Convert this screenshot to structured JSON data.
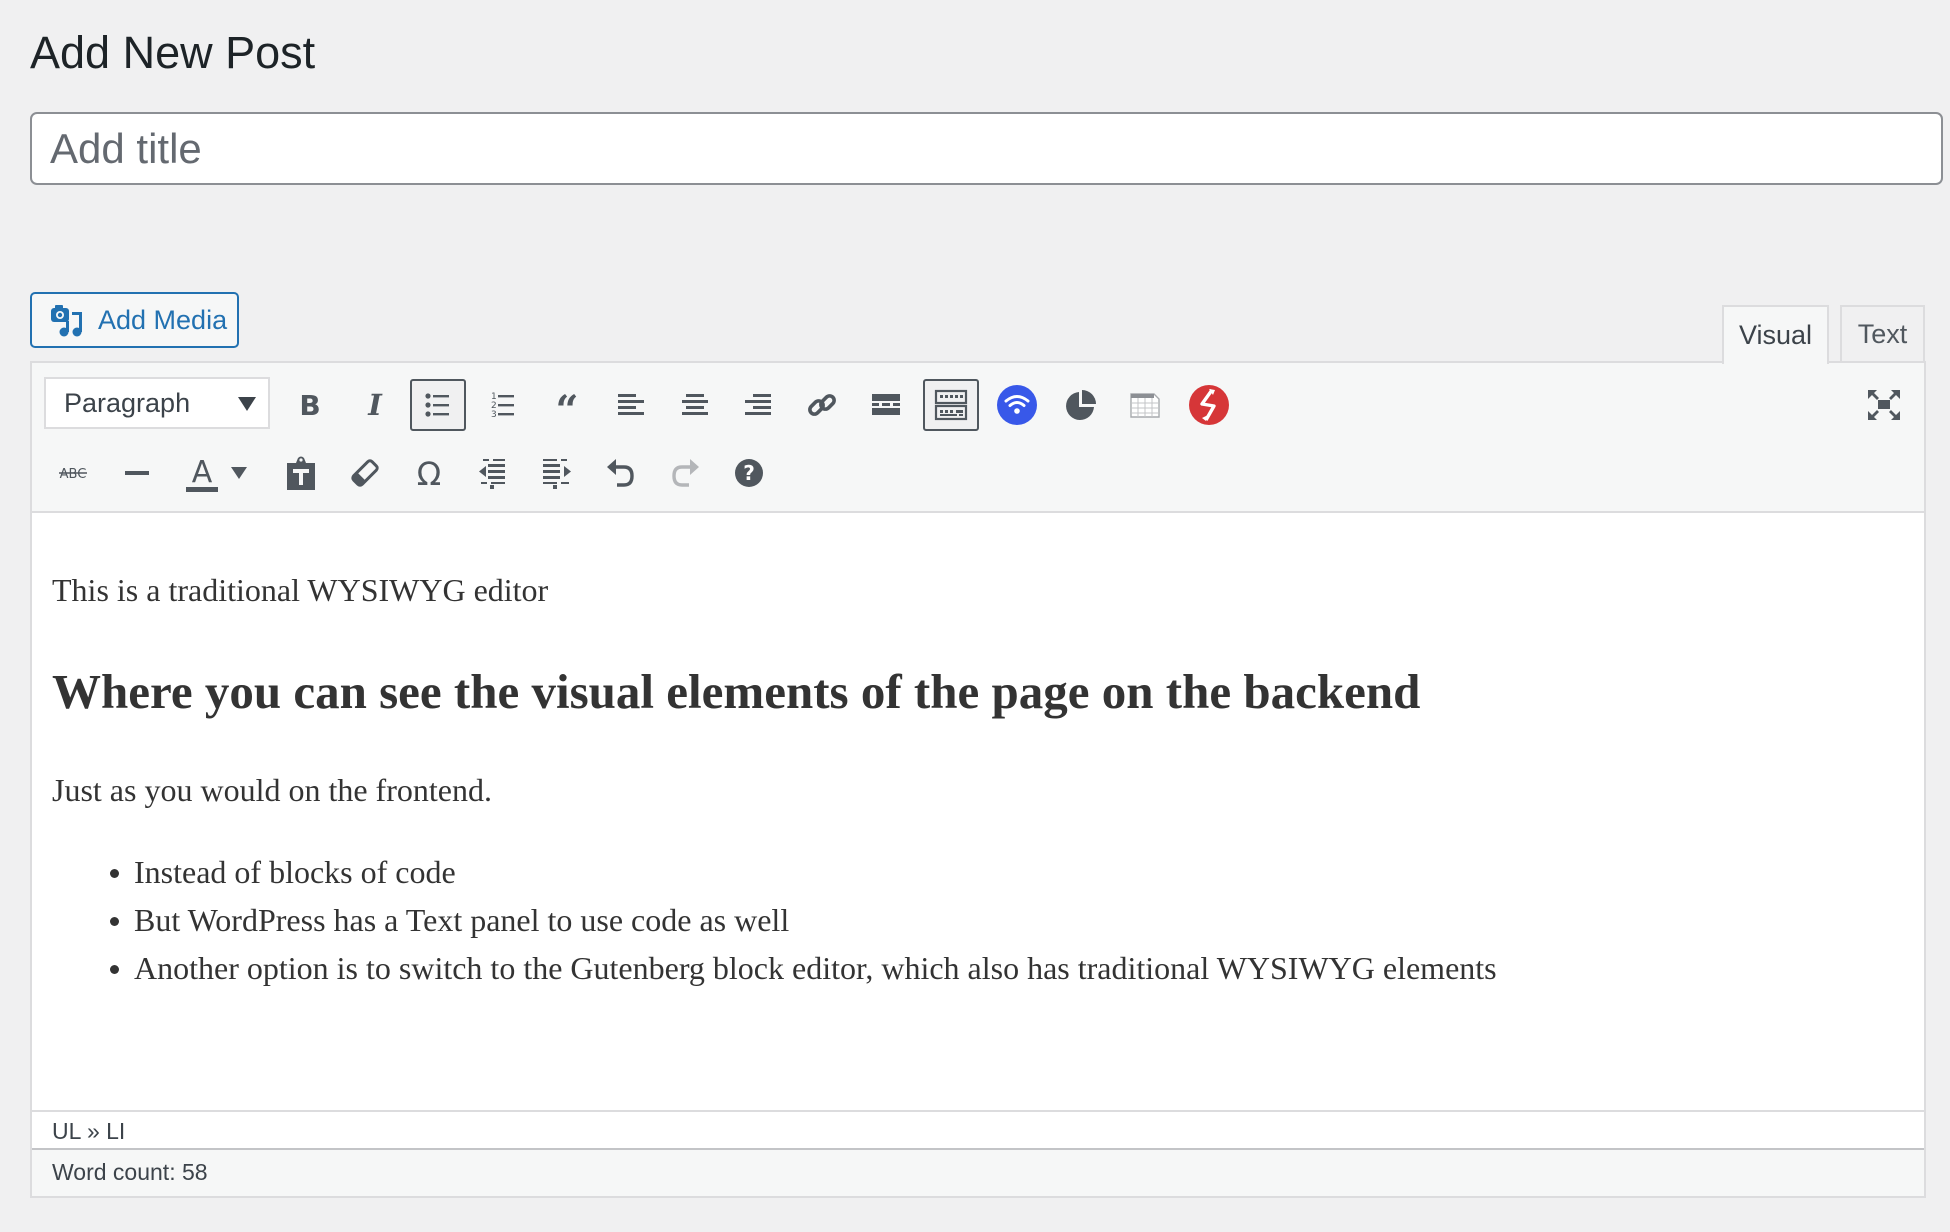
{
  "page": {
    "title": "Add New Post"
  },
  "title_field": {
    "value": "",
    "placeholder": "Add title"
  },
  "media": {
    "add_media_label": "Add Media",
    "icon": "camera-music-icon"
  },
  "editor_tabs": [
    {
      "label": "Visual",
      "active": true
    },
    {
      "label": "Text",
      "active": false
    }
  ],
  "toolbar": {
    "format_select": {
      "selected": "Paragraph"
    },
    "row1": [
      {
        "name": "bold",
        "icon": "bold-icon",
        "active": false
      },
      {
        "name": "italic",
        "icon": "italic-icon",
        "active": false
      },
      {
        "name": "bulleted-list",
        "icon": "bulleted-list-icon",
        "active": true
      },
      {
        "name": "numbered-list",
        "icon": "numbered-list-icon",
        "active": false
      },
      {
        "name": "blockquote",
        "icon": "quote-icon",
        "active": false
      },
      {
        "name": "align-left",
        "icon": "align-left-icon",
        "active": false
      },
      {
        "name": "align-center",
        "icon": "align-center-icon",
        "active": false
      },
      {
        "name": "align-right",
        "icon": "align-right-icon",
        "active": false
      },
      {
        "name": "insert-link",
        "icon": "link-icon",
        "active": false
      },
      {
        "name": "read-more",
        "icon": "read-more-icon",
        "active": false
      },
      {
        "name": "toolbar-toggle",
        "icon": "keyboard-icon",
        "active": true
      },
      {
        "name": "wifi-plugin",
        "icon": "wifi-icon",
        "active": false
      },
      {
        "name": "chart-plugin",
        "icon": "pie-chart-icon",
        "active": false
      },
      {
        "name": "table-plugin",
        "icon": "table-icon",
        "active": false
      },
      {
        "name": "shortcode-plugin",
        "icon": "lightning-icon",
        "active": false
      }
    ],
    "fullscreen_icon": "fullscreen-icon",
    "row2": [
      {
        "name": "strikethrough",
        "icon": "strikethrough-icon",
        "text": "ABC"
      },
      {
        "name": "horizontal-line",
        "icon": "horizontal-line-icon"
      },
      {
        "name": "text-color",
        "icon": "text-color-icon",
        "text": "A"
      },
      {
        "name": "text-color-dropdown",
        "icon": "caret-down-icon"
      },
      {
        "name": "paste-as-text",
        "icon": "paste-text-icon"
      },
      {
        "name": "clear-formatting",
        "icon": "eraser-icon"
      },
      {
        "name": "special-character",
        "icon": "omega-icon",
        "text": "Ω"
      },
      {
        "name": "decrease-indent",
        "icon": "outdent-icon"
      },
      {
        "name": "increase-indent",
        "icon": "indent-icon"
      },
      {
        "name": "undo",
        "icon": "undo-icon"
      },
      {
        "name": "redo",
        "icon": "redo-icon",
        "disabled": true
      },
      {
        "name": "keyboard-shortcuts",
        "icon": "help-icon",
        "text": "?"
      }
    ]
  },
  "content": {
    "paragraph1": "This is a traditional WYSIWYG editor",
    "heading": "Where you can see the visual elements of the page on the backend",
    "paragraph2": "Just as you would on the frontend.",
    "list_items": [
      "Instead of blocks of code",
      "But WordPress has a Text panel to use code as well",
      "Another option is to switch to the Gutenberg block editor, which also has traditional WYSIWYG elements"
    ]
  },
  "status": {
    "path": "UL » LI",
    "word_count": "Word count: 58"
  },
  "colors": {
    "accent": "#2271b1",
    "icon": "#50575e",
    "wifi_plugin": "#3858e9",
    "shortcode_plugin": "#d63638"
  }
}
